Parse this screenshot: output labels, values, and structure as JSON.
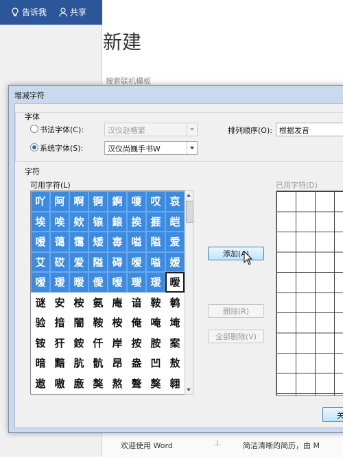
{
  "word": {
    "tell_me": "告诉我",
    "share": "共享",
    "new_title": "新建",
    "search_placeholder": "搜索联机模板",
    "welcome": "欢迎使用 Word",
    "resume": "简洁清晰的简历，由 M"
  },
  "dialog": {
    "title": "增减字符",
    "font_group_label": "字体",
    "calligraphy_font_label": "书法字体(C):",
    "calligraphy_font_value": "汉仪赵楷繁",
    "calligraphy_selected": false,
    "system_font_label": "系统字体(S):",
    "system_font_value": "汉仪尚巍手书W",
    "system_selected": true,
    "sort_label": "排列顺序(O):",
    "sort_value": "根据发音",
    "chars_group_label": "字符",
    "available_label": "可用字符(L)",
    "used_label": "已用字符(D)",
    "add_button": "添加(A)",
    "remove_button": "删除(R)",
    "remove_all_button": "全部删除(V)",
    "ok_button": "关"
  },
  "characters": [
    "吖",
    "阿",
    "啊",
    "锕",
    "錒",
    "嗄",
    "哎",
    "哀",
    "埃",
    "唉",
    "欸",
    "锿",
    "鎄",
    "挨",
    "捱",
    "皑",
    "嗳",
    "蔼",
    "霭",
    "矮",
    "毐",
    "嗌",
    "隘",
    "爱",
    "艾",
    "砹",
    "爱",
    "隘",
    "碍",
    "嗳",
    "嗌",
    "嫒",
    "嗳",
    "瑷",
    "暧",
    "僾",
    "嗳",
    "璦",
    "瑷",
    "暧",
    "谜",
    "安",
    "桉",
    "氨",
    "庵",
    "谙",
    "鞍",
    "鹌",
    "验",
    "揞",
    "闇",
    "鞍",
    "桉",
    "俺",
    "唵",
    "埯",
    "铵",
    "犴",
    "銨",
    "仟",
    "岸",
    "按",
    "胺",
    "案",
    "暗",
    "黯",
    "肮",
    "骯",
    "昂",
    "盎",
    "凹",
    "敖",
    "遨",
    "嗷",
    "廒",
    "獒",
    "熬",
    "聱",
    "獒",
    "翱"
  ],
  "selected_count": 39,
  "focused_index": 39
}
